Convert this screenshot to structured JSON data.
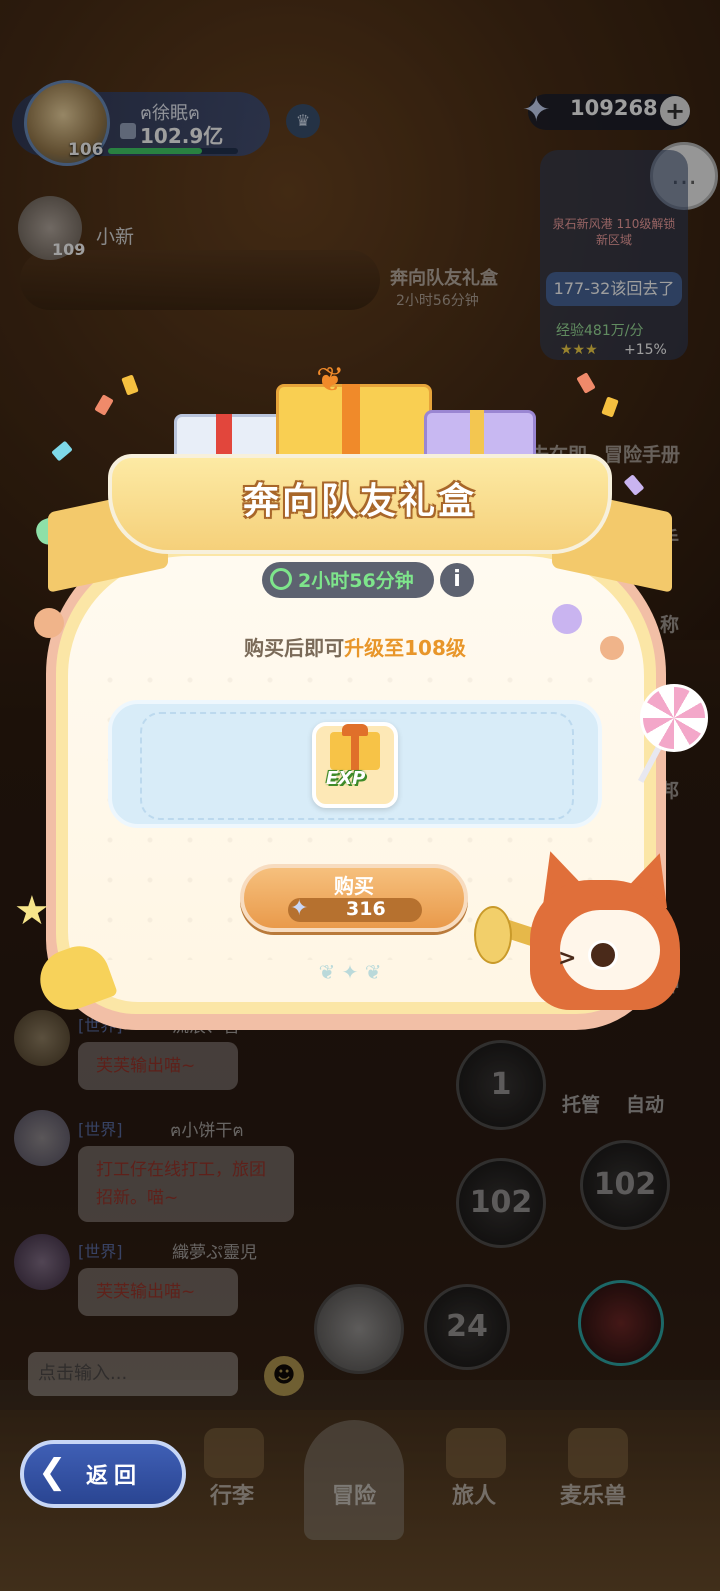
{
  "hud": {
    "player_name": "ฅ徐眠ฅ",
    "player_level": "106",
    "power": "102.9亿",
    "exp_fraction": 0.72,
    "friend_name": "小新",
    "friend_level": "109",
    "currency_value": "109268",
    "currency_plus": "+",
    "currency_icon": "star-crystal-icon"
  },
  "background": {
    "gift_title": "奔向队友礼盒",
    "gift_timer": "2小时56分钟",
    "quest_text": "泉石新风港 110级解锁新区域",
    "quest_stage": "177-32该回去了",
    "quest_exp": "经验481万/分",
    "quest_stars": "★★★",
    "quest_bonus": "+15%",
    "side_menu": [
      "去在即",
      "冒险手册",
      "手",
      "称",
      "邦",
      "钟"
    ]
  },
  "chat": {
    "messages": [
      {
        "channel": "[世界]",
        "user": "流浪、音",
        "text": "芙芙输出喵~"
      },
      {
        "channel": "[世界]",
        "user": "ฅ小饼干ฅ",
        "text": "打工仔在线打工，旅团招新。喵~"
      },
      {
        "channel": "[世界]",
        "user": "織夢ぷ靈児",
        "text": "芙芙输出喵~"
      }
    ],
    "input_placeholder": "点击输入...",
    "emoji_icon": "☻"
  },
  "battle": {
    "skills": [
      "1",
      "102",
      "102",
      "24"
    ],
    "auto_labels": [
      "托管",
      "自动"
    ]
  },
  "nav": {
    "items": [
      "行李",
      "冒险",
      "旅人",
      "麦乐兽"
    ],
    "back_label": "返回",
    "back_icon": "❮"
  },
  "modal": {
    "title": "奔向队友礼盒",
    "timer": "2小时56分钟",
    "info_icon": "i",
    "desc_prefix": "购买后即可",
    "desc_highlight": "升级至108级",
    "reward_label": "EXP",
    "buy_label": "购买",
    "buy_price": "316",
    "buy_currency_icon": "star-crystal-icon"
  },
  "colors": {
    "accent_green": "#7ee58b",
    "highlight_orange": "#e8962a",
    "ribbon_gold": "#f5d07a",
    "button_orange": "#e99a4b"
  }
}
